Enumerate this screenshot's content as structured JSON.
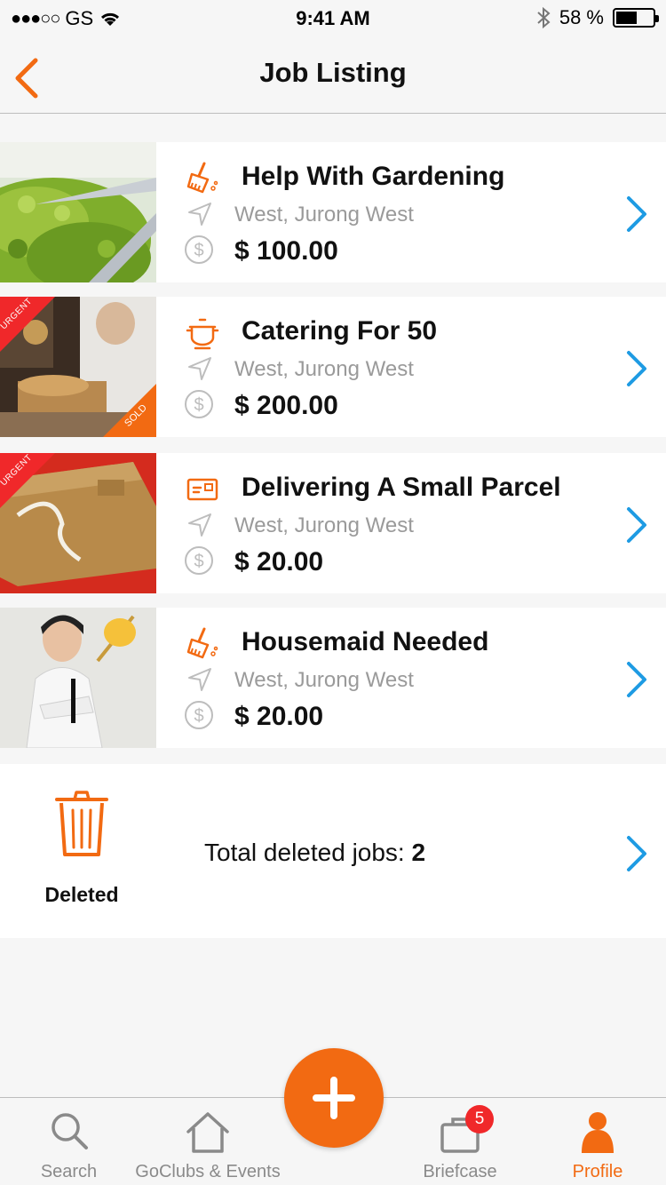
{
  "status_bar": {
    "carrier": "GS",
    "time": "9:41 AM",
    "battery": "58 %",
    "battery_level": 0.58
  },
  "nav": {
    "title": "Job Listing"
  },
  "jobs": [
    {
      "title": "Help With Gardening",
      "location": "West, Jurong West",
      "price": "$ 100.00",
      "icon": "broom-icon",
      "ribbons": []
    },
    {
      "title": "Catering For 50",
      "location": "West, Jurong West",
      "price": "$ 200.00",
      "icon": "pot-icon",
      "ribbons": [
        "URGENT",
        "SOLD"
      ]
    },
    {
      "title": "Delivering A Small Parcel",
      "location": "West, Jurong West",
      "price": "$ 20.00",
      "icon": "parcel-icon",
      "ribbons": [
        "URGENT"
      ]
    },
    {
      "title": "Housemaid Needed",
      "location": "West, Jurong West",
      "price": "$ 20.00",
      "icon": "broom-icon",
      "ribbons": []
    }
  ],
  "deleted": {
    "label": "Deleted",
    "text": "Total deleted jobs: ",
    "count": "2"
  },
  "tabs": [
    {
      "label": "Search",
      "icon": "search-icon"
    },
    {
      "label": "GoClubs & Events",
      "icon": "home-icon"
    },
    {
      "label": "Briefcase",
      "icon": "briefcase-icon",
      "badge": "5"
    },
    {
      "label": "Profile",
      "icon": "profile-icon",
      "active": true
    }
  ],
  "colors": {
    "accent": "#f26a12",
    "chevron": "#1e9be3",
    "badge": "#f0282a"
  }
}
